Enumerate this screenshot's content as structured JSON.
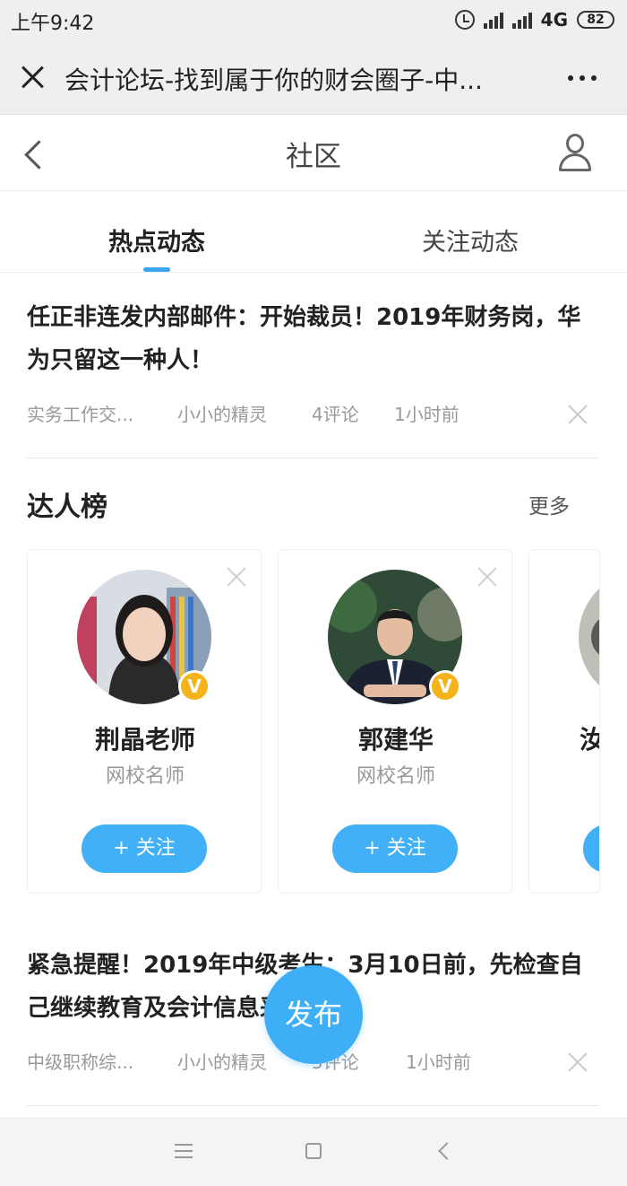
{
  "status_bar": {
    "time": "上午9:42",
    "network": "4G",
    "battery": "82"
  },
  "title_bar": {
    "title": "会计论坛-找到属于你的财会圈子-中..."
  },
  "nav": {
    "title": "社区"
  },
  "tabs": [
    {
      "label": "热点动态",
      "active": true
    },
    {
      "label": "关注动态",
      "active": false
    }
  ],
  "articles": [
    {
      "title": "任正非连发内部邮件：开始裁员！2019年财务岗，华为只留这一种人！",
      "category": "实务工作交...",
      "author": "小小的精灵",
      "comments": "4评论",
      "time": "1小时前"
    },
    {
      "title": "紧急提醒！2019年中级考生：3月10日前，先检查自己继续教育及会计信息采集……",
      "category": "中级职称综...",
      "author": "小小的精灵",
      "comments": "5评论",
      "time": "1小时前"
    }
  ],
  "experts": {
    "title": "达人榜",
    "more": "更多",
    "badge": "V",
    "items": [
      {
        "name": "荆晶老师",
        "role": "网校名师",
        "follow": "+ 关注"
      },
      {
        "name": "郭建华",
        "role": "网校名师",
        "follow": "+ 关注"
      },
      {
        "name": "汝",
        "role": "",
        "follow": ""
      }
    ]
  },
  "fab": {
    "label": "发布"
  },
  "colors": {
    "accent": "#3ba6f4",
    "badge": "#f5b31b"
  }
}
